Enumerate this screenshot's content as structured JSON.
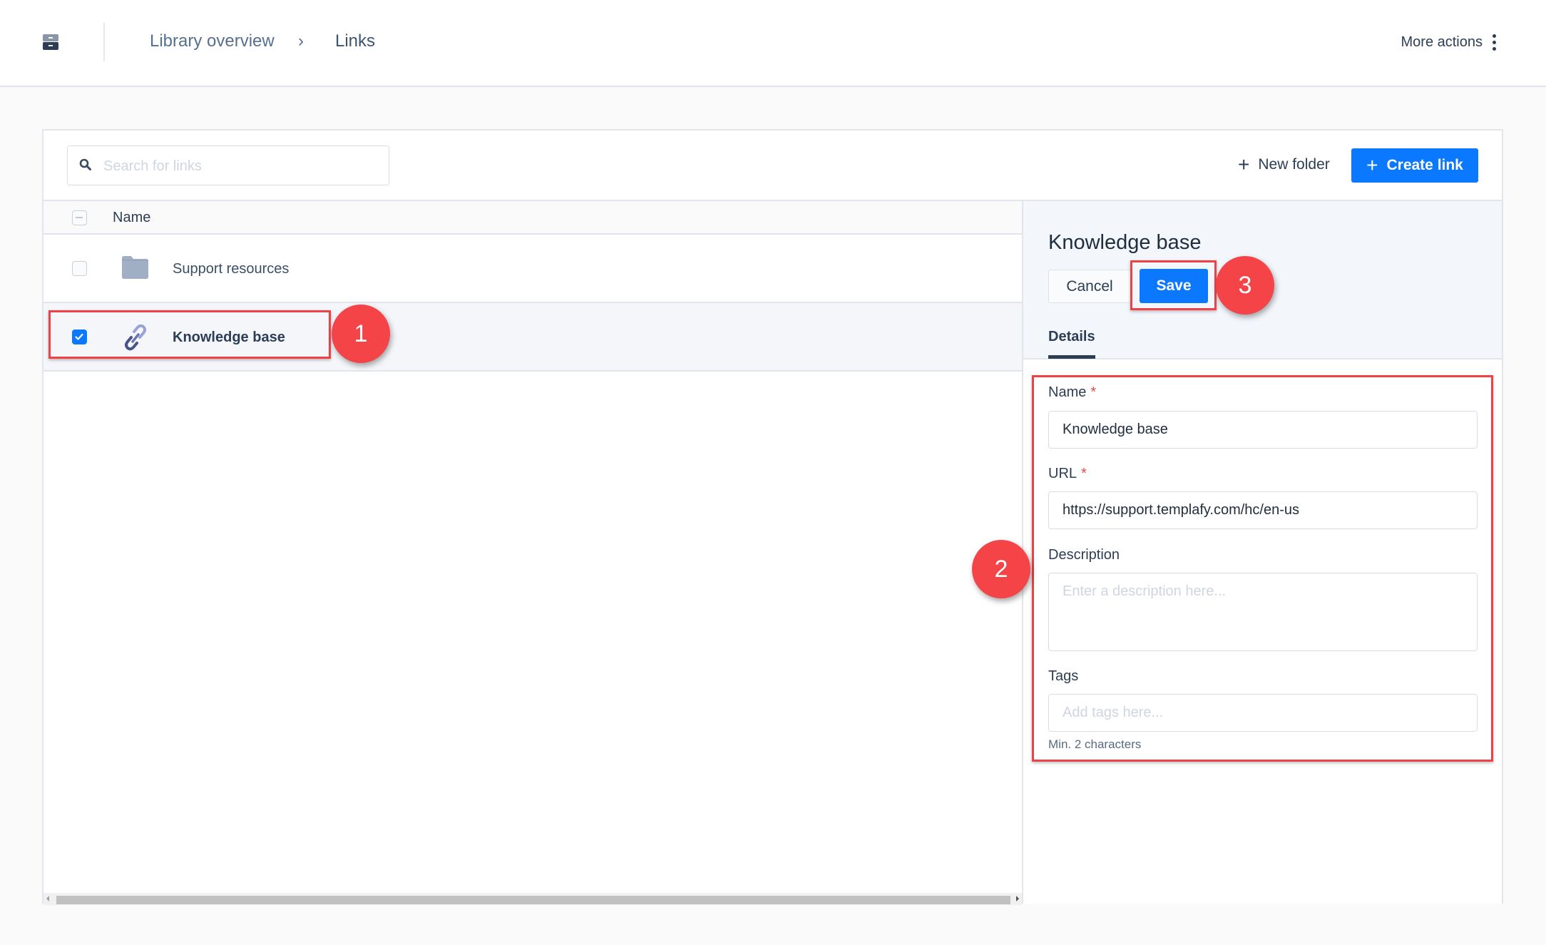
{
  "header": {
    "app_icon": "archive-cabinet-icon",
    "breadcrumb": [
      {
        "label": "Library overview"
      },
      {
        "separator": "›"
      },
      {
        "label": "Links"
      }
    ],
    "more_actions_label": "More actions",
    "more_actions_icon": "kebab-vertical-icon"
  },
  "toolbar": {
    "search_placeholder": "Search for links",
    "search_value": "",
    "new_folder_label": "New folder",
    "create_link_label": "Create link",
    "plus_glyph": "+"
  },
  "list": {
    "column_header": "Name",
    "rows": [
      {
        "name": "Support resources",
        "type": "folder",
        "checked": false
      },
      {
        "name": "Knowledge base",
        "type": "link",
        "checked": true
      }
    ]
  },
  "panel": {
    "title": "Knowledge base",
    "cancel_label": "Cancel",
    "save_label": "Save",
    "tabs": [
      {
        "label": "Details",
        "active": true
      }
    ],
    "fields": {
      "name": {
        "label": "Name",
        "required_mark": "*",
        "value": "Knowledge base"
      },
      "url": {
        "label": "URL",
        "required_mark": "*",
        "value": "https://support.templafy.com/hc/en-us"
      },
      "description": {
        "label": "Description",
        "placeholder": "Enter a description here...",
        "value": ""
      },
      "tags": {
        "label": "Tags",
        "placeholder": "Add tags here...",
        "value": "",
        "hint": "Min. 2 characters"
      }
    }
  },
  "annotations": {
    "callouts": [
      "1",
      "2",
      "3"
    ],
    "color": "#f44448"
  },
  "colors": {
    "primary": "#0a78ff",
    "text": "#2c3e55",
    "required": "#e5484d",
    "annotation": "#ef4246"
  }
}
